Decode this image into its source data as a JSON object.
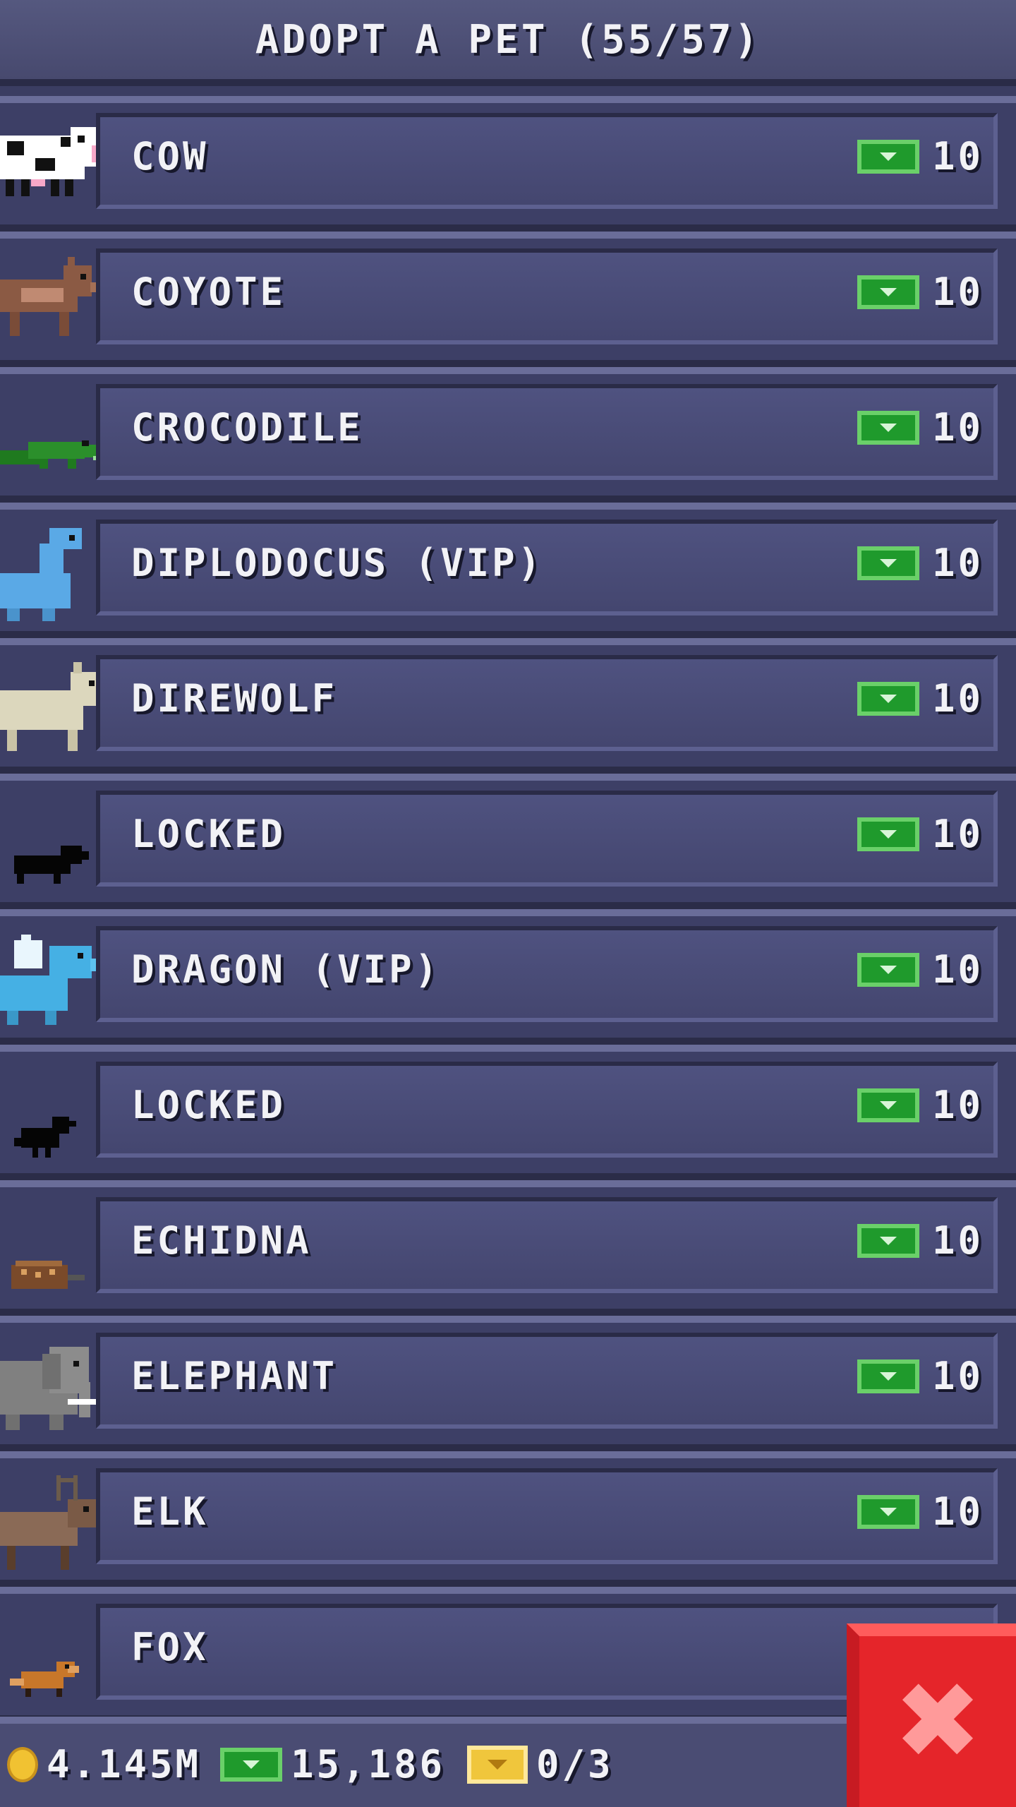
{
  "header": {
    "title": "ADOPT A PET (55/57)"
  },
  "pets": [
    {
      "label": "COW",
      "price": "10",
      "icon": "cow-icon"
    },
    {
      "label": "COYOTE",
      "price": "10",
      "icon": "coyote-icon"
    },
    {
      "label": "CROCODILE",
      "price": "10",
      "icon": "crocodile-icon"
    },
    {
      "label": "DIPLODOCUS (VIP)",
      "price": "10",
      "icon": "diplodocus-icon"
    },
    {
      "label": "DIREWOLF",
      "price": "10",
      "icon": "direwolf-icon"
    },
    {
      "label": "LOCKED",
      "price": "10",
      "icon": "locked-pet-silhouette-icon"
    },
    {
      "label": "DRAGON (VIP)",
      "price": "10",
      "icon": "dragon-icon"
    },
    {
      "label": "LOCKED",
      "price": "10",
      "icon": "locked-bird-silhouette-icon"
    },
    {
      "label": "ECHIDNA",
      "price": "10",
      "icon": "echidna-icon"
    },
    {
      "label": "ELEPHANT",
      "price": "10",
      "icon": "elephant-icon"
    },
    {
      "label": "ELK",
      "price": "10",
      "icon": "elk-icon"
    },
    {
      "label": "FOX",
      "price": "",
      "icon": "fox-icon"
    }
  ],
  "footer": {
    "coins": "4.145M",
    "cash": "15,186",
    "tickets": "0/3"
  },
  "close_button": {
    "glyph": "✖"
  },
  "colors": {
    "cash_green": "#1f9a2c",
    "close_red": "#e5252a",
    "coin_gold": "#f1c232"
  }
}
